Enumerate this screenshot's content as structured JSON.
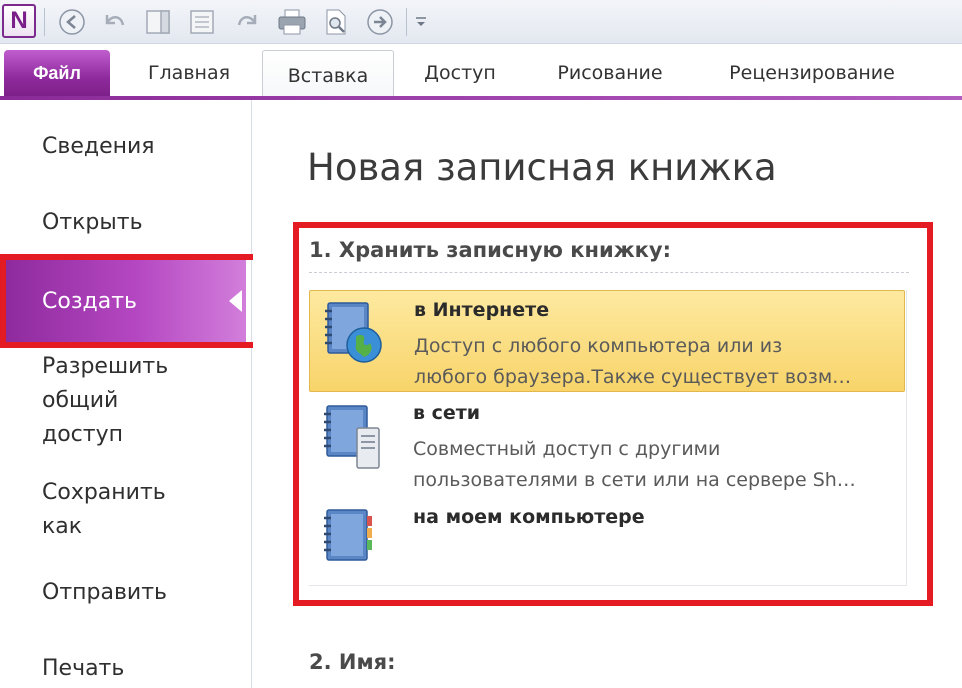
{
  "app": {
    "logo_letter": "N"
  },
  "quick_access": {
    "items": [
      "back-icon",
      "undo-icon",
      "dock-icon",
      "normal-view-icon",
      "redo-icon",
      "print-icon",
      "print-preview-icon",
      "forward-icon",
      "customize-icon"
    ]
  },
  "ribbon": {
    "file_tab": "Файл",
    "tabs": [
      "Главная",
      "Вставка",
      "Доступ",
      "Рисование",
      "Рецензирование"
    ],
    "active_tab": "Вставка"
  },
  "nav": {
    "items": [
      {
        "label": "Сведения"
      },
      {
        "label": "Открыть"
      },
      {
        "label": "Создать",
        "selected": true
      },
      {
        "label_lines": [
          "Разрешить",
          "общий",
          "доступ"
        ]
      },
      {
        "label_lines": [
          "Сохранить",
          "как"
        ]
      },
      {
        "label": "Отправить"
      },
      {
        "label": "Печать"
      }
    ]
  },
  "main": {
    "title": "Новая записная книжка",
    "section1_heading": "1. Хранить записную книжку:",
    "options": [
      {
        "title": "в Интернете",
        "desc_lines": [
          "Доступ с любого компьютера или из",
          "любого браузера.Также существует возм…"
        ],
        "icon": "notebook-globe-icon",
        "highlighted": true
      },
      {
        "title": "в сети",
        "desc_lines": [
          "Совместный доступ с другими",
          "пользователями в сети или на сервере Sh…"
        ],
        "icon": "notebook-server-icon",
        "highlighted": false
      },
      {
        "title": "на моем компьютере",
        "desc_lines": [],
        "icon": "notebook-icon",
        "highlighted": false
      }
    ],
    "section2_heading": "2. Имя:"
  },
  "colors": {
    "accent_purple": "#8f2b9d",
    "highlight_red": "#e51b24",
    "hover_yellow": "#f8d46a"
  }
}
